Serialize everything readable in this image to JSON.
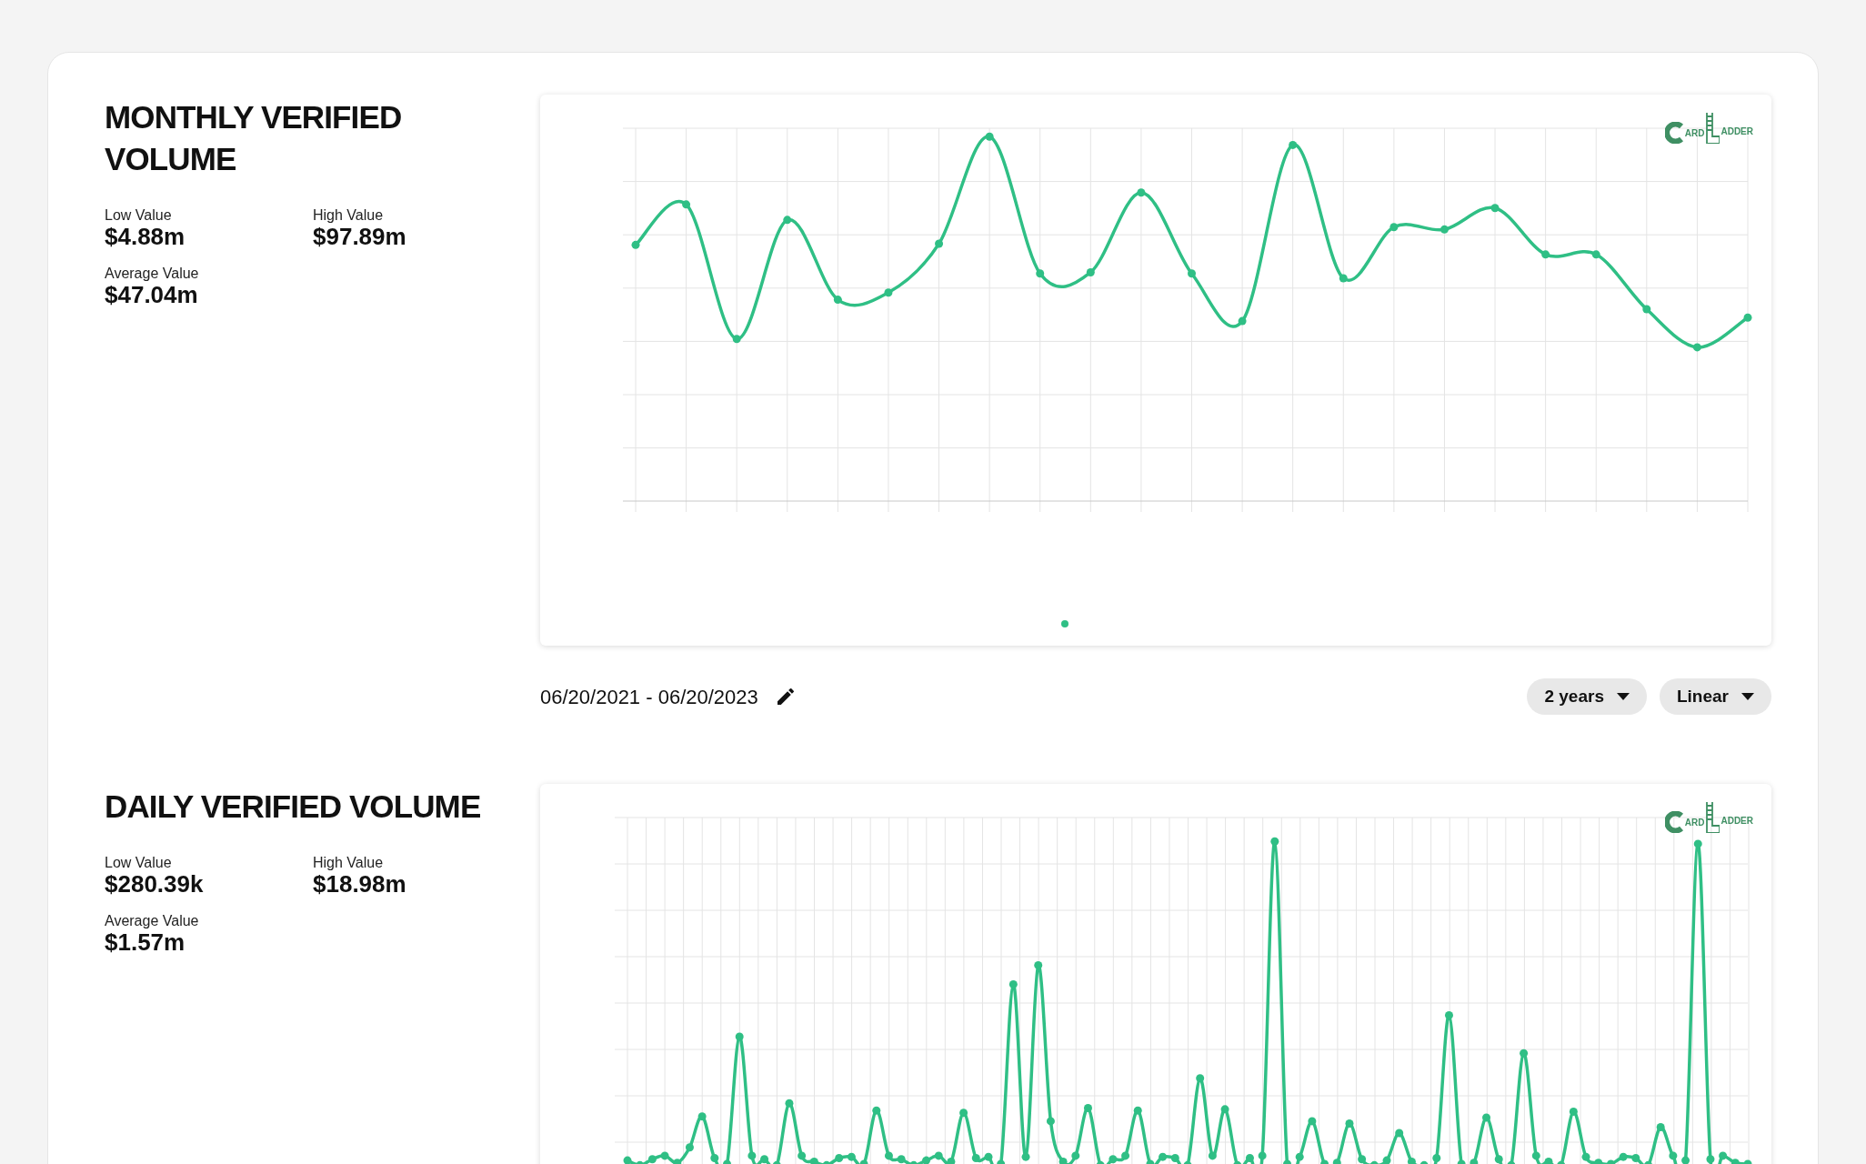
{
  "sections": [
    {
      "title": "MONTHLY VERIFIED VOLUME",
      "stats": [
        {
          "label": "Low Value",
          "value": "$4.88m"
        },
        {
          "label": "High Value",
          "value": "$97.89m"
        },
        {
          "label": "Average Value",
          "value": "$47.04m"
        }
      ],
      "kind": "monthly",
      "logo": {
        "first": "ARD",
        "second": "ADDER"
      },
      "date_range": "06/20/2021 - 06/20/2023",
      "dropdowns": [
        "2 years",
        "Linear"
      ]
    },
    {
      "title": "DAILY VERIFIED VOLUME",
      "stats": [
        {
          "label": "Low Value",
          "value": "$280.39k"
        },
        {
          "label": "High Value",
          "value": "$18.98m"
        },
        {
          "label": "Average Value",
          "value": "$1.57m"
        }
      ],
      "kind": "daily",
      "logo": {
        "first": "ARD",
        "second": "ADDER"
      }
    }
  ]
}
